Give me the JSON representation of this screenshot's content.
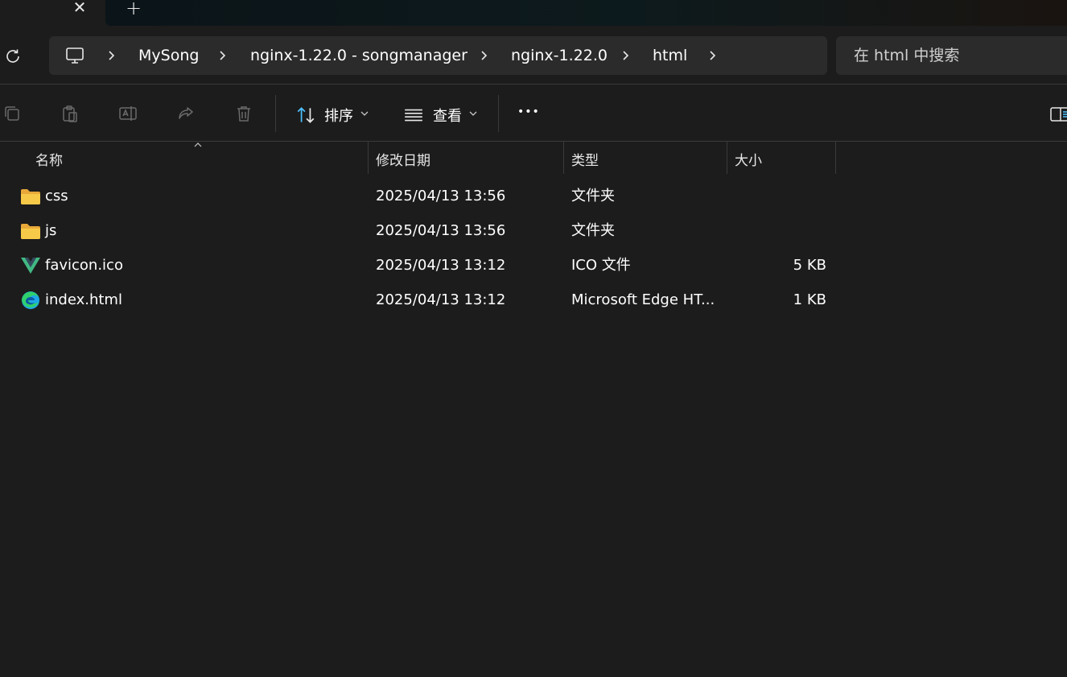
{
  "tabs": {
    "close_glyph": "✕",
    "add_glyph": "+"
  },
  "breadcrumb": {
    "root_icon": "this-pc-icon",
    "items": [
      "MySong",
      "nginx-1.22.0 - songmanager",
      "nginx-1.22.0",
      "html"
    ]
  },
  "search": {
    "placeholder": "在 html 中搜索"
  },
  "toolbar": {
    "icons": [
      "copy-icon",
      "paste-icon",
      "rename-icon",
      "share-icon",
      "delete-icon"
    ],
    "sort_label": "排序",
    "view_label": "查看",
    "more_glyph": "•••"
  },
  "columns": {
    "name": "名称",
    "modified": "修改日期",
    "type": "类型",
    "size": "大小"
  },
  "files": [
    {
      "name": "css",
      "icon": "folder-icon",
      "modified": "2025/04/13 13:56",
      "type": "文件夹",
      "size": ""
    },
    {
      "name": "js",
      "icon": "folder-icon",
      "modified": "2025/04/13 13:56",
      "type": "文件夹",
      "size": ""
    },
    {
      "name": "favicon.ico",
      "icon": "vue-icon",
      "modified": "2025/04/13 13:12",
      "type": "ICO 文件",
      "size": "5 KB"
    },
    {
      "name": "index.html",
      "icon": "edge-icon",
      "modified": "2025/04/13 13:12",
      "type": "Microsoft Edge HT...",
      "size": "1 KB"
    }
  ],
  "colors": {
    "background": "#1c1c1c",
    "field": "#2b2b2b",
    "folder": "#f7c948",
    "accent": "#4cc2ff"
  }
}
